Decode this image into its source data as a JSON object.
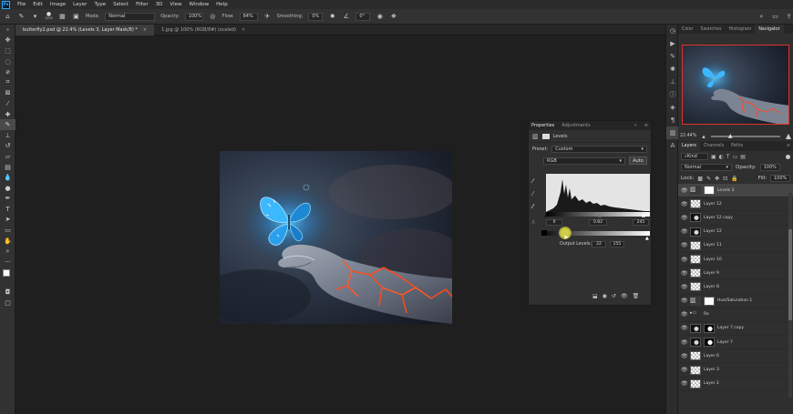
{
  "menubar": {
    "logo": "Ps",
    "items": [
      "File",
      "Edit",
      "Image",
      "Layer",
      "Type",
      "Select",
      "Filter",
      "3D",
      "View",
      "Window",
      "Help"
    ]
  },
  "options": {
    "brush_size": "1000",
    "mode_label": "Mode:",
    "mode_value": "Normal",
    "opacity_label": "Opacity:",
    "opacity_value": "100%",
    "flow_label": "Flow:",
    "flow_value": "64%",
    "smoothing_label": "Smoothing:",
    "smoothing_value": "0%",
    "angle_value": "0°"
  },
  "tabs": [
    {
      "label": "butterfly2.psd @ 22.4% (Levels 3, Layer Mask/8) *",
      "active": true
    },
    {
      "label": "1.jpg @ 100% (RGB/8#) (scaled)",
      "active": false
    }
  ],
  "properties": {
    "tab_properties": "Properties",
    "tab_adjustments": "Adjustments",
    "type_label": "Levels",
    "preset_label": "Preset:",
    "preset_value": "Custom",
    "channel_value": "RGB",
    "auto_button": "Auto",
    "input_black": "0",
    "input_gamma": "0.82",
    "input_white": "245",
    "output_label": "Output Levels:",
    "output_black": "22",
    "output_white": "255"
  },
  "right_panel": {
    "top_tabs": [
      "Color",
      "Swatches",
      "Histogram",
      "Navigator"
    ],
    "active_top_tab": "Navigator",
    "zoom": "22.44%",
    "layer_tabs": [
      "Layers",
      "Channels",
      "Paths"
    ],
    "kind_value": "Kind",
    "blend_value": "Normal",
    "opacity_label": "Opacity:",
    "opacity_value": "100%",
    "lock_label": "Lock:",
    "fill_label": "Fill:",
    "fill_value": "100%"
  },
  "layers": [
    {
      "name": "Levels 3",
      "selected": true,
      "thumb": "levels",
      "mask": "white"
    },
    {
      "name": "Layer 12",
      "selected": false,
      "thumb": "checker",
      "mask": ""
    },
    {
      "name": "Layer 12 copy",
      "selected": false,
      "thumb": "dark",
      "mask": ""
    },
    {
      "name": "Layer 12",
      "selected": false,
      "thumb": "dark",
      "mask": ""
    },
    {
      "name": "Layer 11",
      "selected": false,
      "thumb": "checker",
      "mask": ""
    },
    {
      "name": "Layer 10",
      "selected": false,
      "thumb": "checker",
      "mask": ""
    },
    {
      "name": "Layer 9",
      "selected": false,
      "thumb": "checker",
      "mask": ""
    },
    {
      "name": "Layer 8",
      "selected": false,
      "thumb": "checker",
      "mask": ""
    },
    {
      "name": "Hue/Saturation 1",
      "selected": false,
      "thumb": "levels",
      "mask": "white"
    },
    {
      "name": "Ra",
      "selected": false,
      "thumb": "folder",
      "mask": ""
    },
    {
      "name": "Layer 7 copy",
      "selected": false,
      "thumb": "dark",
      "mask": "dark"
    },
    {
      "name": "Layer 7",
      "selected": false,
      "thumb": "dark",
      "mask": "dark"
    },
    {
      "name": "Layer 6",
      "selected": false,
      "thumb": "checker",
      "mask": ""
    },
    {
      "name": "Layer 3",
      "selected": false,
      "thumb": "checker",
      "mask": ""
    },
    {
      "name": "Layer 2",
      "selected": false,
      "thumb": "checker",
      "mask": ""
    }
  ],
  "colors": {
    "accent": "#31a8ff",
    "nav_frame": "#e0322c",
    "glow": "#39b6ff",
    "lava": "#ff4a1e"
  }
}
